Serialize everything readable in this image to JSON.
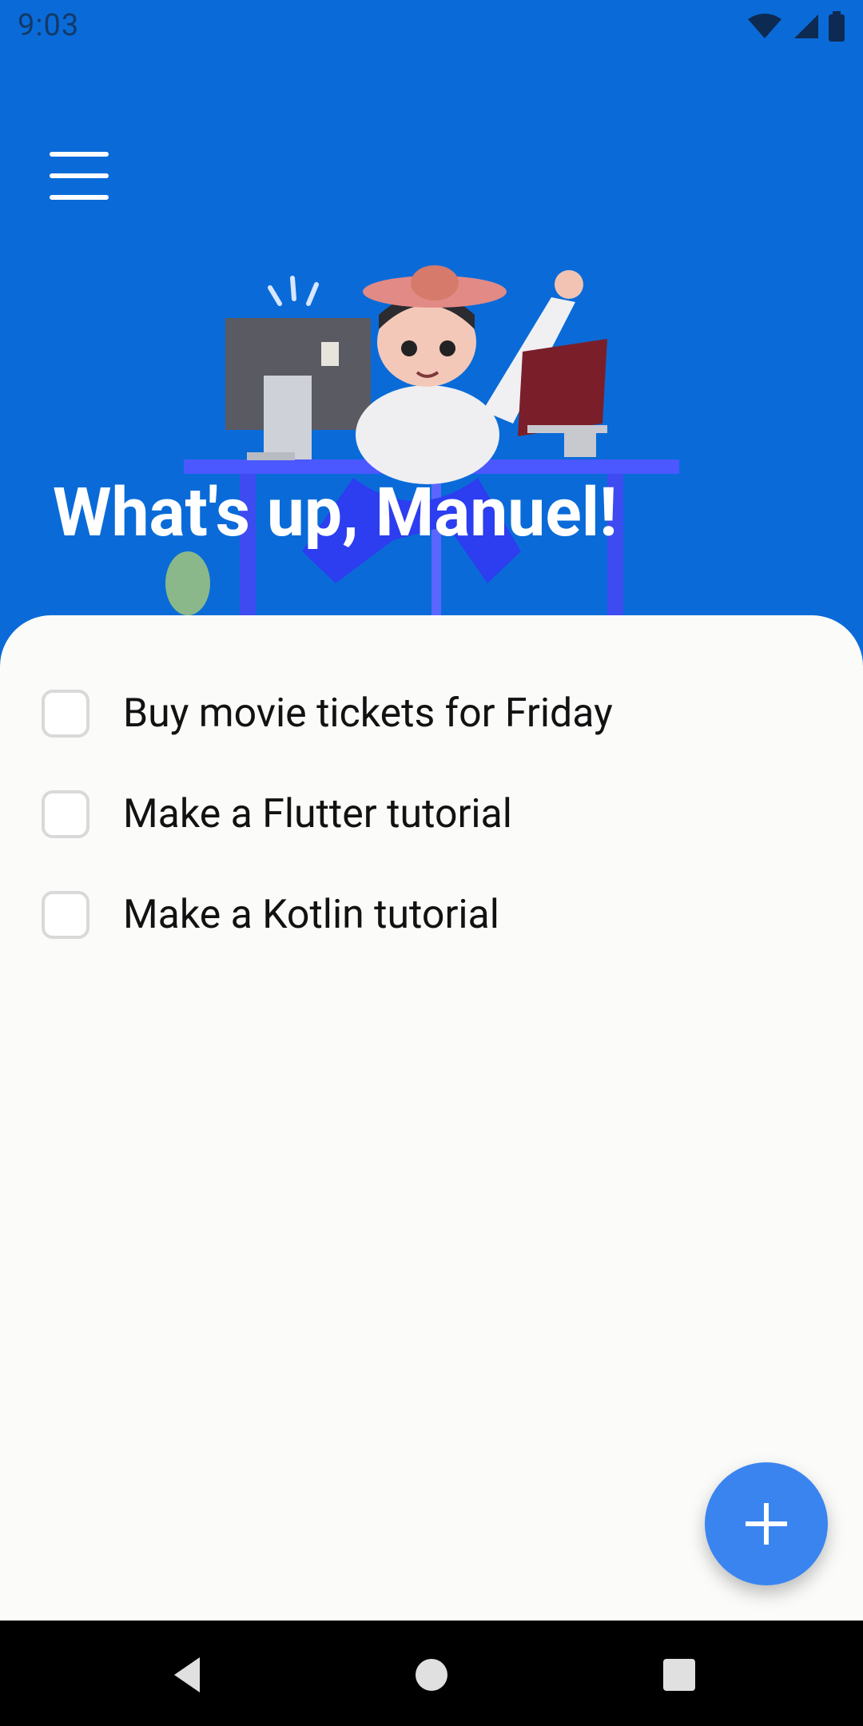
{
  "status_bar": {
    "time": "9:03",
    "icons": [
      "wifi-icon",
      "cell-signal-icon",
      "battery-icon"
    ]
  },
  "header": {
    "menu_icon": "hamburger-menu-icon",
    "greeting": "What's up, Manuel!",
    "illustration": "person-at-desk-illustration"
  },
  "tasks": [
    {
      "label": "Buy movie tickets for Friday",
      "checked": false
    },
    {
      "label": "Make a Flutter tutorial",
      "checked": false
    },
    {
      "label": "Make a Kotlin tutorial",
      "checked": false
    }
  ],
  "fab": {
    "icon": "plus-icon"
  },
  "navigation": {
    "buttons": [
      "back-icon",
      "home-icon",
      "recents-icon"
    ]
  },
  "colors": {
    "background": "#0a6bd8",
    "sheet": "#fbfbf9",
    "fab": "#3a84f0",
    "title": "#ffffff"
  }
}
